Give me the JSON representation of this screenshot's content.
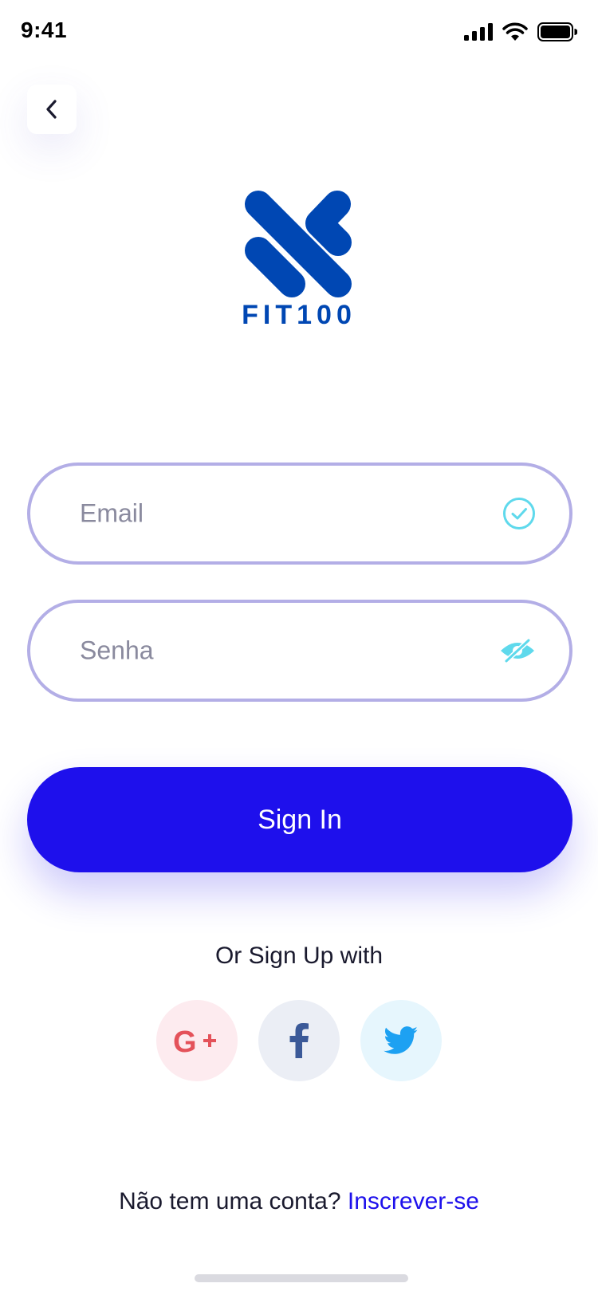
{
  "status_bar": {
    "time": "9:41"
  },
  "back_button": {
    "icon": "chevron-left-icon"
  },
  "logo": {
    "text": "FIT100",
    "color": "#0047B3"
  },
  "form": {
    "email": {
      "value": "",
      "placeholder": "Email",
      "icon": "check-circle-icon"
    },
    "password": {
      "value": "",
      "placeholder": "Senha",
      "icon": "eye-off-icon"
    },
    "submit_label": "Sign In"
  },
  "social": {
    "heading": "Or Sign Up with",
    "providers": [
      {
        "name": "Google Plus",
        "icon": "google-plus-icon",
        "color": "#E4525A",
        "bg": "#FDEBEF"
      },
      {
        "name": "Facebook",
        "icon": "facebook-icon",
        "color": "#3B5998",
        "bg": "#EBEEF5"
      },
      {
        "name": "Twitter",
        "icon": "twitter-icon",
        "color": "#1DA1F2",
        "bg": "#E6F6FD"
      }
    ]
  },
  "footer": {
    "prompt": "Não tem uma conta?",
    "link_label": "Inscrever-se"
  },
  "colors": {
    "accent": "#1E10EC",
    "field_border": "#B3AEE6",
    "field_icon": "#5FD9EC"
  }
}
